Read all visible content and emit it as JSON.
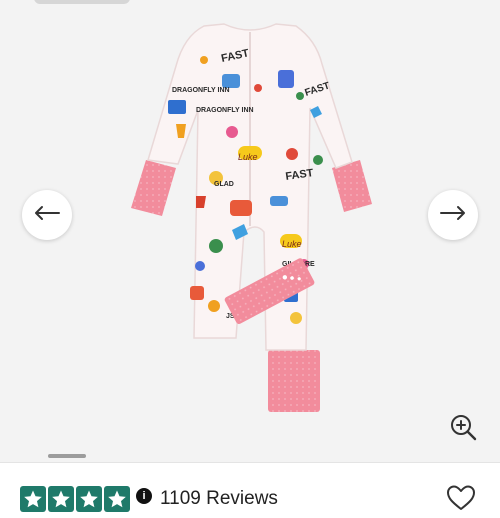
{
  "gallery": {
    "product_image_alt": "Pink romper with colorful illustrated pattern",
    "prev_icon": "arrow-left-icon",
    "next_icon": "arrow-right-icon",
    "zoom_icon": "zoom-in-icon",
    "slide_current": 1
  },
  "product_print": {
    "texts": [
      "FAST",
      "DRAGONFLY INN",
      "DRAGONFLY INN",
      "Luke",
      "FAST",
      "Luke",
      "FAST",
      "GILMORE",
      "JSM",
      "GLAD"
    ]
  },
  "rating": {
    "stars": 5,
    "star_icon": "star-icon",
    "info_icon": "info-icon",
    "info_symbol": "i",
    "reviews_text": "1109 Reviews"
  },
  "wishlist": {
    "icon": "heart-icon"
  },
  "colors": {
    "gallery_bg": "#f3f3f3",
    "romper_base": "#fbf4f4",
    "cuff_pink": "#f28c9c",
    "star_green": "#1f7a6a"
  }
}
